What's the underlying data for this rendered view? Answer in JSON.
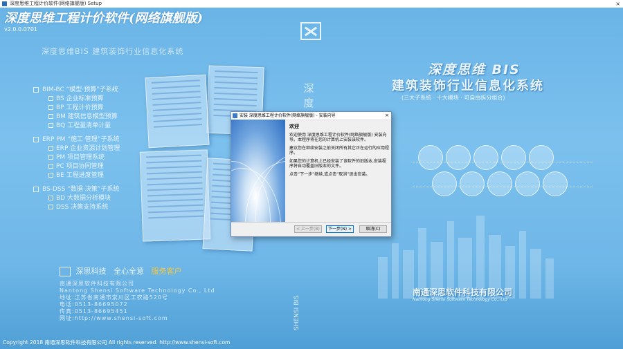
{
  "window": {
    "title": "深度思维工程计价软件(网络旗舰版) Setup",
    "close_symbol": "×"
  },
  "splash": {
    "app_title": "深度思维工程计价软件(网络旗舰版)",
    "version": "v2.0.0.0701",
    "left_headline": "深度思维BIS 建筑装饰行业信息化系统",
    "sections": [
      {
        "head": "BIM-BC “模型·预算”子系统",
        "items": [
          "BS 企业标准预算",
          "BP 工程计价预算",
          "BM 建筑信息模型预算",
          "BQ 工程量清单计量"
        ]
      },
      {
        "head": "ERP PM “施工·管理”子系统",
        "items": [
          "ERP 企业资源计划管理",
          "PM 项目管理系统",
          "PC 项目协同管理",
          "BE 工程进度管理"
        ]
      },
      {
        "head": "BS-DSS “数据·决策”子系统",
        "items": [
          "BD 大数据分析模块",
          "DSS 决策支持系统"
        ]
      }
    ],
    "vertical_text": "深度思维系统",
    "right_title_line1": "深度思维 BIS",
    "right_title_line2": "建筑装饰行业信息化系统",
    "right_subtitle": "(三大子系统 · 十大模块 · 可自由拆分组合)",
    "slogan_brand": "深思科技",
    "slogan_text": "全心全意",
    "slogan_highlight": "服务客户",
    "contact": [
      "南通深思软件科技有限公司",
      "Nantong Shensi Software Technology Co., Ltd",
      "地址:江苏省南通市崇川区工农路520号",
      "电话:0513-86695072",
      "传真:0513-86695451",
      "网址:http://www.shensi-soft.com"
    ],
    "brand_vertical": "SHENSI BIS",
    "company_cn_right": "南通深思软件科技有限公司",
    "company_en_right": "Nantong Shensi Software Technology Co., Ltd",
    "copyright": "Copyright 2018 南通深思软件科技有限公司 All rights reserved. http://www.shensi-soft.com"
  },
  "dialog": {
    "title": "安装 深度思维工程计价软件(网络旗舰版) - 安装向导",
    "close_symbol": "×",
    "welcome": "欢迎",
    "paragraphs": [
      "欢迎使用 深度思维工程计价软件(网络旗舰版) 安装向导。本程序将在您的计算机上安装该软件。",
      "建议您在继续安装之前关闭所有其它正在运行的应用程序。",
      "如果您的计算机上已经安装了该软件的旧版本,安装程序将自动覆盖旧版本的文件。",
      "点击“下一步”继续,或点击“取消”退出安装。"
    ],
    "back_label": "< 上一步(B)",
    "next_label": "下一步(N) >",
    "cancel_label": "取消(C)"
  },
  "colors": {
    "background": "#7cc1ee",
    "slogan_highlight": "#f5c742",
    "dialog_accent": "#0078d7"
  }
}
